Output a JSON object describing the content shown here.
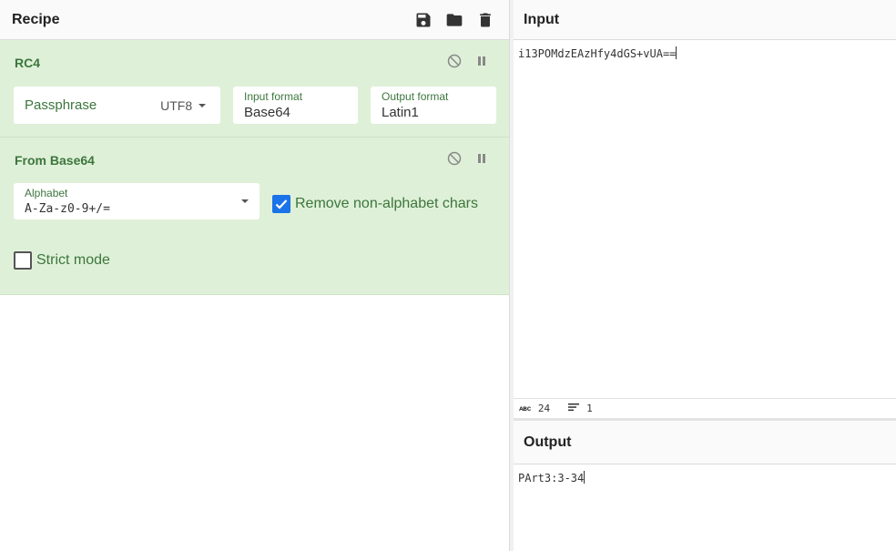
{
  "recipe": {
    "title": "Recipe",
    "operations": [
      {
        "name": "RC4",
        "passphrase": {
          "label": "Passphrase",
          "encoding": "UTF8"
        },
        "input_format": {
          "label": "Input format",
          "value": "Base64"
        },
        "output_format": {
          "label": "Output format",
          "value": "Latin1"
        }
      },
      {
        "name": "From Base64",
        "alphabet": {
          "label": "Alphabet",
          "value": "A-Za-z0-9+/="
        },
        "remove_non_alphabet": {
          "label": "Remove non-alphabet chars",
          "checked": true
        },
        "strict_mode": {
          "label": "Strict mode",
          "checked": false
        }
      }
    ]
  },
  "input": {
    "title": "Input",
    "text": "i13POMdzEAzHfy4dGS+vUA==",
    "stats": {
      "length": "24",
      "lines": "1"
    }
  },
  "output": {
    "title": "Output",
    "text": "PArt3:3-34"
  },
  "colors": {
    "op_bg": "#dff0d8",
    "label_green": "#3c763d",
    "check_blue": "#1a73e8"
  }
}
